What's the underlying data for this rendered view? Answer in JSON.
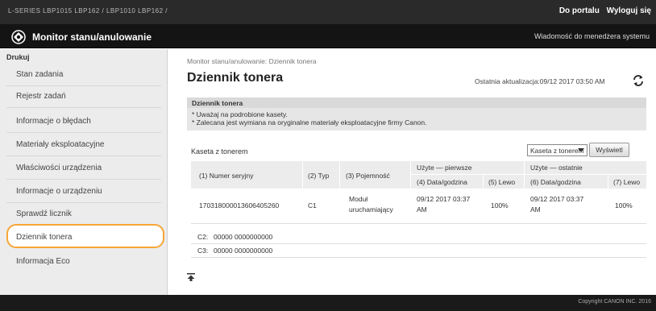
{
  "topbar": {
    "model": "L-SERIES      LBP1015 LBP162 / LBP1010 LBP162 /",
    "portal_link": "Do portalu",
    "logout_link": "Wyloguj się"
  },
  "appbar": {
    "title": "Monitor stanu/anulowanie",
    "message_link": "Wiadomość do menedżera systemu"
  },
  "sidebar": {
    "section": "Drukuj",
    "items": [
      {
        "label": "Stan zadania"
      },
      {
        "label": "Rejestr zadań"
      },
      {
        "label": "Informacje o błędach"
      },
      {
        "label": "Materiały eksploatacyjne"
      },
      {
        "label": "Właściwości urządzenia"
      },
      {
        "label": "Informacje o urządzeniu"
      },
      {
        "label": "Sprawdź licznik"
      },
      {
        "label": "Dziennik tonera"
      },
      {
        "label": "Informacja Eco"
      }
    ],
    "highlight_color": "#f7a636"
  },
  "main": {
    "breadcrumb": "Monitor stanu/anulowanie: Dziennik tonera",
    "title": "Dziennik tonera",
    "last_update": "Ostatnia aktualizacja:09/12 2017 03:50 AM",
    "info": {
      "header": "Dziennik tonera",
      "note1": "* Uważaj na podrobione kasety.",
      "note2": "* Zalecana jest wymiana na oryginalne materiały eksploatacyjne firmy Canon."
    },
    "cartridge_label": "Kaseta z tonerem",
    "select_value": "Kaseta z tonerem",
    "show_button": "Wyświetl",
    "table": {
      "headers": {
        "serial": "(1) Numer seryjny",
        "type": "(2) Typ",
        "capacity": "(3) Pojemność",
        "first_group": "Użyte — pierwsze",
        "first_date": "(4) Data/godzina",
        "first_left": "(5) Lewo",
        "last_group": "Użyte — ostatnie",
        "last_date": "(6) Data/godzina",
        "last_left": "(7) Lewo"
      },
      "row": {
        "serial": "170318000013606405260",
        "type": "C1",
        "capacity_line1": "Moduł",
        "capacity_line2": "uruchamiający",
        "first_date_line1": "09/12 2017 03:37",
        "first_date_line2": "AM",
        "first_left": "100%",
        "last_date_line1": "09/12 2017 03:37",
        "last_date_line2": "AM",
        "last_left": "100%"
      }
    },
    "other_cartridges": [
      {
        "code": "C2:",
        "serial": "00000 0000000000"
      },
      {
        "code": "C3:",
        "serial": "00000 0000000000"
      }
    ]
  },
  "footer": {
    "copyright": "Copyright CANON INC. 2016"
  }
}
